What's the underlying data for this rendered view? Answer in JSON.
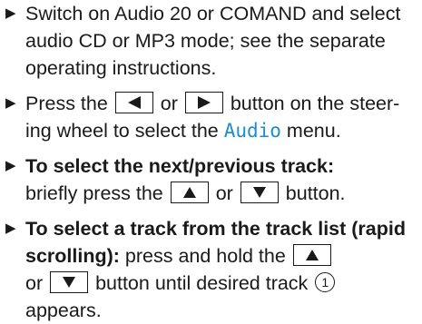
{
  "steps": [
    {
      "text": "Switch on Audio 20 or COMAND and select audio CD or MP3 mode; see the separate operating instructions."
    },
    {
      "before": "Press the ",
      "key1": "left-arrow",
      "mid": " or ",
      "key2": "right-arrow",
      "after1": " button on the steer-ing wheel to select the ",
      "menu": "Audio",
      "after2": " menu."
    },
    {
      "heading": "To select the next/previous track:",
      "before": "briefly press the ",
      "key1": "up-arrow",
      "mid": " or ",
      "key2": "down-arrow",
      "after": " button."
    },
    {
      "heading": "To select a track from the track list (rapid scrolling):",
      "before": " press and hold the ",
      "key1": "up-arrow",
      "mid": " or ",
      "key2": "down-arrow",
      "after1": " button until desired track ",
      "marker": "1",
      "after2": " appears."
    }
  ]
}
